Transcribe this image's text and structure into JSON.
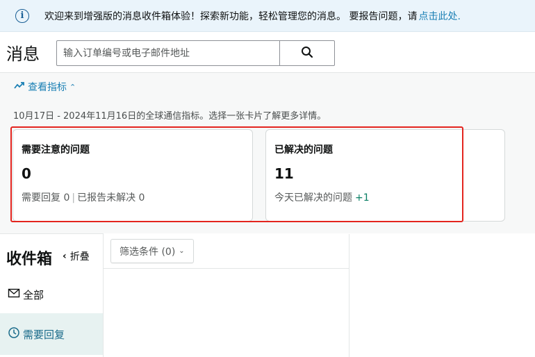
{
  "banner": {
    "icon": "info-icon",
    "text": "欢迎来到增强版的消息收件箱体验！探索新功能，轻松管理您的消息。 要报告问题，请",
    "link": "点击此处."
  },
  "header": {
    "title": "消息",
    "search_placeholder": "输入订单编号或电子邮件地址",
    "search_icon": "search-icon"
  },
  "metrics": {
    "toggle_label": "查看指标",
    "range_text": "10月17日 - 2024年11月16日的全球通信指标。选择一张卡片了解更多详情。",
    "cards": [
      {
        "title": "需要注意的问题",
        "value": "0",
        "sub_a": "需要回复 0",
        "sub_b": "已报告未解决 0"
      },
      {
        "title": "已解决的问题",
        "value": "11",
        "sub_a": "今天已解决的问题",
        "delta": "+1"
      }
    ],
    "highlight_color": "#e3241e"
  },
  "inbox": {
    "title": "收件箱",
    "collapse_label": "折叠",
    "nav": [
      {
        "label": "全部",
        "icon": "mail-icon"
      },
      {
        "label": "需要回复",
        "icon": "clock-icon",
        "active": true
      }
    ],
    "filter_label": "筛选条件 (0)"
  },
  "colors": {
    "link": "#1a7fb4",
    "banner_bg": "#eaf4fb",
    "active_nav_bg": "#e7f2f1",
    "positive": "#067d62"
  }
}
